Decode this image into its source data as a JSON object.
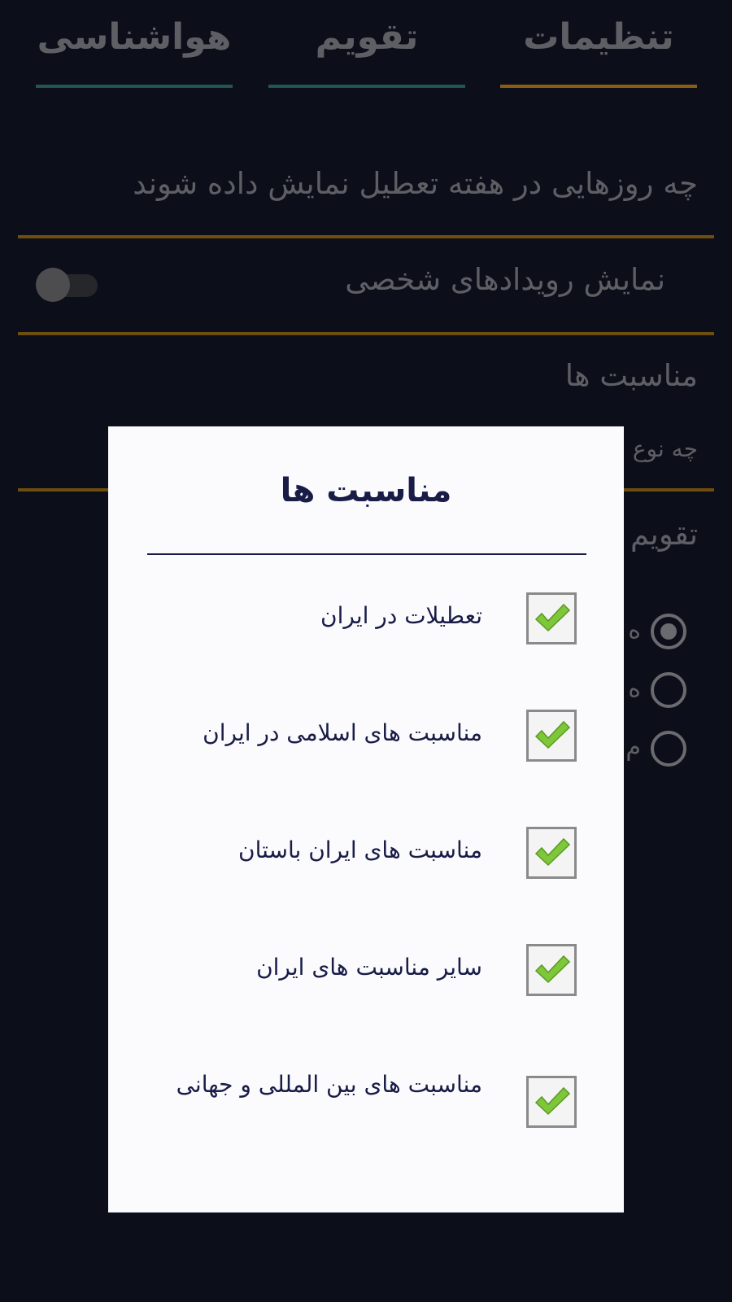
{
  "tabs": [
    {
      "label": "تنظیمات",
      "underline": "#8a5e12"
    },
    {
      "label": "تقویم",
      "underline": "#245454"
    },
    {
      "label": "هواشناسی",
      "underline": "#245454"
    }
  ],
  "settings": {
    "holidays_days_label": "چه روزهایی در هفته تعطیل نمایش داده شوند",
    "personal_events_label": "نمایش رویدادهای شخصی",
    "personal_events_enabled": false,
    "occasions_title": "مناسبت ها",
    "occasions_subtitle": "چه نوع",
    "calendar_type_title": "تقویم",
    "radio_options": [
      {
        "label": "ه",
        "selected": true
      },
      {
        "label": "ه",
        "selected": false
      },
      {
        "label": "م",
        "selected": false
      }
    ]
  },
  "dialog": {
    "title": "مناسبت ها",
    "options": [
      {
        "label": "تعطیلات در ایران",
        "checked": true
      },
      {
        "label": "مناسبت های اسلامی در ایران",
        "checked": true
      },
      {
        "label": "مناسبت های ایران باستان",
        "checked": true
      },
      {
        "label": "سایر مناسبت های ایران",
        "checked": true
      },
      {
        "label": "مناسبت های بین المللی و جهانی",
        "checked": true
      }
    ]
  },
  "colors": {
    "background": "#0c0e19",
    "accent_gold": "#8a5e12",
    "accent_teal": "#245454",
    "dialog_text": "#181c46",
    "check_green": "#7ec63a"
  },
  "icons": {
    "checkbox": "checkmark-icon",
    "radio": "radio-icon",
    "toggle": "toggle-switch"
  }
}
